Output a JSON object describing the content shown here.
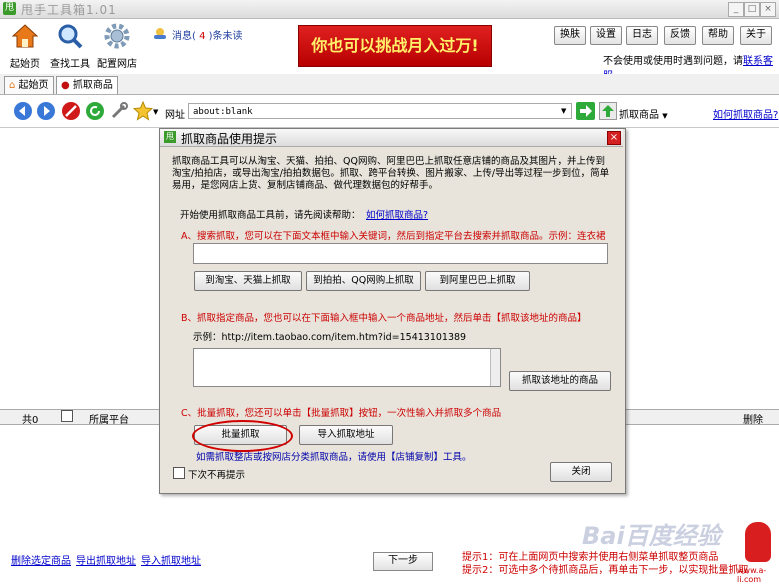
{
  "window": {
    "title": "甩手工具箱1.01",
    "icon_char": "甩",
    "minimize": "_",
    "maximize": "□",
    "close": "×"
  },
  "toolbar": {
    "tools": [
      {
        "label": "起始页",
        "icon": "home-icon"
      },
      {
        "label": "查找工具",
        "icon": "search-icon"
      },
      {
        "label": "配置网店",
        "icon": "gear-icon"
      }
    ],
    "messages_prefix": "消息(",
    "messages_count": "4",
    "messages_suffix": ")条未读",
    "banner": "你也可以挑战月入过万!",
    "buttons": [
      "换肤",
      "设置",
      "日志",
      "反馈",
      "帮助",
      "关于"
    ],
    "help_text": "不会使用或使用时遇到问题，请",
    "help_link": "联系客服"
  },
  "tabs": [
    {
      "label": "起始页"
    },
    {
      "label": "抓取商品"
    }
  ],
  "nav": {
    "address_label": "网址",
    "address_value": "about:blank",
    "grab_label": "抓取商品",
    "how_to_link": "如何抓取商品?"
  },
  "list": {
    "count": "共0",
    "platform": "所属平台",
    "delete": "删除"
  },
  "bottom": {
    "links": [
      "删除选定商品",
      "导出抓取地址",
      "导入抓取地址"
    ],
    "next": "下一步",
    "tip1": "提示1：可在上面网页中搜索并使用右侧菜单抓取整页商品",
    "tip2": "提示2：可选中多个待抓商品后，再单击下一步，以实现批量抓取"
  },
  "dialog": {
    "title": "抓取商品使用提示",
    "intro": "抓取商品工具可以从淘宝、天猫、拍拍、QQ网购、阿里巴巴上抓取任意店铺的商品及其图片，并上传到淘宝/拍拍店，或导出淘宝/拍拍数据包。抓取、跨平台转换、图片搬家、上传/导出等过程一步到位，简单易用，是您网店上货、复制店铺商品、做代理数据包的好帮手。",
    "read_help": "开始使用抓取商品工具前，请先阅读帮助：",
    "read_help_link": "如何抓取商品?",
    "section_a": "A、搜索抓取，您可以在下面文本框中输入关键词，然后到指定平台去搜索并抓取商品。示例：连衣裙",
    "btn_taobao": "到淘宝、天猫上抓取",
    "btn_paipai": "到拍拍、QQ网购上抓取",
    "btn_alibaba": "到阿里巴巴上抓取",
    "section_b": "B、抓取指定商品，您也可以在下面输入框中输入一个商品地址，然后单击【抓取该地址的商品】",
    "example_b": "示例：http://item.taobao.com/item.htm?id=15413101389",
    "btn_grab_url": "抓取该地址的商品",
    "section_c": "C、批量抓取，您还可以单击【批量抓取】按钮，一次性输入并抓取多个商品",
    "btn_batch": "批量抓取",
    "btn_import": "导入抓取地址",
    "shop_note": "如需抓取整店或按网店分类抓取商品，请使用【店铺复制】工具。",
    "no_show": "下次不再提示",
    "close": "关闭"
  },
  "watermark": "Bai百度经验",
  "site": "www.a-li.com"
}
